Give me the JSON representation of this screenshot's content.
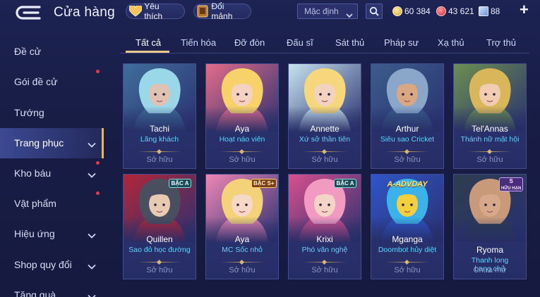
{
  "header": {
    "title": "Cửa hàng",
    "favorites_label": "Yêu thích",
    "fragment_label": "Đổi mảnh",
    "sort_value": "Mặc định",
    "currency": {
      "gold": "60 384",
      "gems": "43 621",
      "vouchers": "88"
    },
    "add_label": "+"
  },
  "sidebar": {
    "items": [
      {
        "label": "Đề cử",
        "dot": false,
        "chevron": false
      },
      {
        "label": "Gói đề cử",
        "dot": true,
        "chevron": false
      },
      {
        "label": "Tướng",
        "dot": false,
        "chevron": false
      },
      {
        "label": "Trang phục",
        "dot": false,
        "chevron": true,
        "active": true
      },
      {
        "label": "Kho báu",
        "dot": true,
        "chevron": true
      },
      {
        "label": "Vật phẩm",
        "dot": true,
        "chevron": false
      },
      {
        "label": "Hiệu ứng",
        "dot": false,
        "chevron": true
      },
      {
        "label": "Shop quy đổi",
        "dot": false,
        "chevron": true
      },
      {
        "label": "Tặng quà",
        "dot": false,
        "chevron": true
      }
    ]
  },
  "tabs": [
    {
      "label": "Tất cả",
      "active": true
    },
    {
      "label": "Tiến hóa"
    },
    {
      "label": "Đỡ đòn"
    },
    {
      "label": "Đấu sĩ"
    },
    {
      "label": "Sát thủ"
    },
    {
      "label": "Pháp sư"
    },
    {
      "label": "Xạ thủ"
    },
    {
      "label": "Trợ thủ"
    }
  ],
  "skins": [
    {
      "hero": "Tachi",
      "skin": "Lãng khách",
      "status": "Sở hữu",
      "badge": "",
      "palette": [
        "#9ad7e8",
        "#3f6e9a",
        "#e0c2b2"
      ]
    },
    {
      "hero": "Aya",
      "skin": "Hoạt náo viên",
      "status": "Sở hữu",
      "badge": "",
      "palette": [
        "#f7d16a",
        "#e36b8a",
        "#f3d2bf"
      ]
    },
    {
      "hero": "Annette",
      "skin": "Xứ sở thần tiên",
      "status": "Sở hữu",
      "badge": "",
      "palette": [
        "#f6d77c",
        "#c7e3ef",
        "#f2d3c0"
      ]
    },
    {
      "hero": "Arthur",
      "skin": "Siêu sao Cricket",
      "status": "Sở hữu",
      "badge": "",
      "palette": [
        "#8aa7c9",
        "#3a5d8c",
        "#d9a782"
      ]
    },
    {
      "hero": "Tel'Annas",
      "skin": "Thánh nữ mặt hội",
      "status": "Sở hữu",
      "badge": "",
      "palette": [
        "#d9b65a",
        "#6b8f4f",
        "#f0cdb0"
      ]
    },
    {
      "hero": "Quillen",
      "skin": "Sao đỏ học đường",
      "status": "Sở hữu",
      "badge": "BẬC A",
      "badge_style": "a",
      "palette": [
        "#4a4f5f",
        "#b3263a",
        "#e8c9b2"
      ]
    },
    {
      "hero": "Aya",
      "skin": "MC Sốc nhỏ",
      "status": "Sở hữu",
      "badge": "BẬC S+",
      "badge_style": "s-plus",
      "palette": [
        "#f3d27a",
        "#ef86b6",
        "#f6d8c6"
      ]
    },
    {
      "hero": "Krixi",
      "skin": "Phó văn nghệ",
      "status": "Sở hữu",
      "badge": "BẬC A",
      "badge_style": "a",
      "palette": [
        "#f19ac2",
        "#d84f8f",
        "#f4d4c6"
      ]
    },
    {
      "hero": "Mganga",
      "skin": "Doombot hủy diệt",
      "status": "Sở hữu",
      "badge": "",
      "banner": "A-ADVDAY",
      "palette": [
        "#3bb3ea",
        "#2f55c8",
        "#f4cf3e"
      ]
    },
    {
      "hero": "Ryoma",
      "skin": "Thanh long bang chủ",
      "status": "Chưa mở",
      "badge": "S",
      "badge_sub": "HỮU HẠN",
      "badge_style": "s-limited",
      "palette": [
        "#c89a7a",
        "#2e3d4e",
        "#d7a98a"
      ]
    }
  ]
}
